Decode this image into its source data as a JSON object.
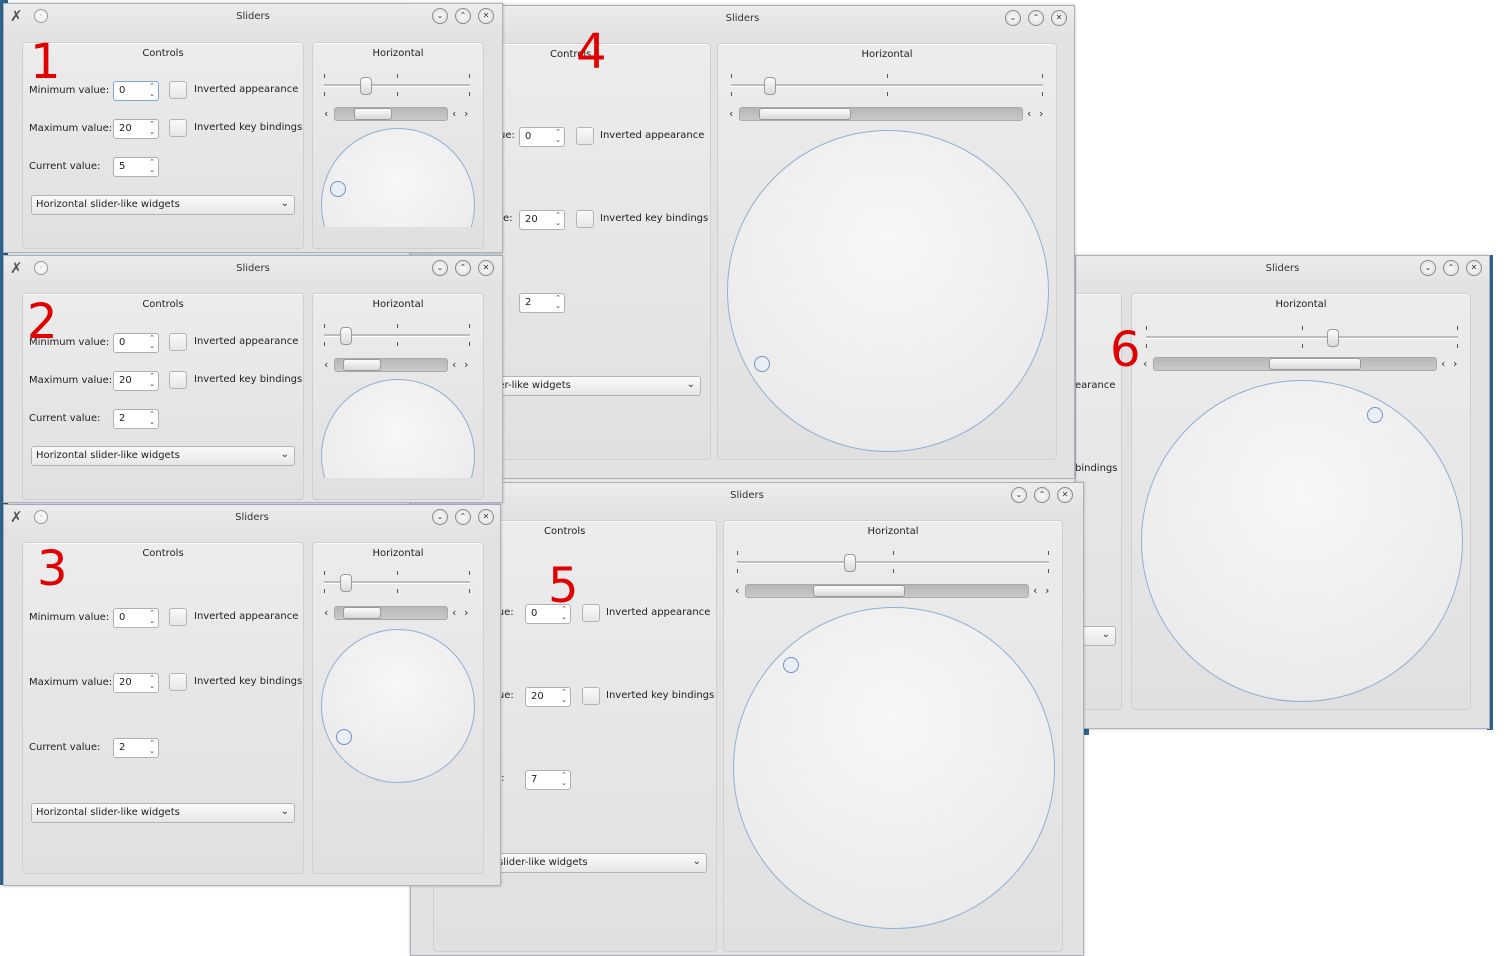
{
  "window_title": "Sliders",
  "controls_title": "Controls",
  "horizontal_title": "Horizontal",
  "labels": {
    "min": "Minimum value:",
    "max": "Maximum value:",
    "cur": "Current value:",
    "min_part": "ue:",
    "max_part": "e:",
    "cur_part": "e:",
    "min_part5": "lue:",
    "max_part5": "alue:",
    "cur_part5": "e:",
    "inv_app": "Inverted appearance",
    "inv_key": "Inverted key bindings",
    "inv_app_part": "earance",
    "inv_key_part": "bindings",
    "combo": "Horizontal slider-like widgets",
    "combo_part4": "der-like widgets",
    "combo_part5": "slider-like widgets",
    "controls_part": "Controls"
  },
  "annotations": [
    "1",
    "2",
    "3",
    "4",
    "5",
    "6"
  ],
  "windows": [
    {
      "id": "w1",
      "min": "0",
      "max": "20",
      "current": "5",
      "slider_fraction": 0.25
    },
    {
      "id": "w2",
      "min": "0",
      "max": "20",
      "current": "2",
      "slider_fraction": 0.1
    },
    {
      "id": "w3",
      "min": "0",
      "max": "20",
      "current": "2",
      "slider_fraction": 0.1
    },
    {
      "id": "w4",
      "min": "0",
      "max": "20",
      "current": "2",
      "slider_fraction": 0.1
    },
    {
      "id": "w5",
      "min": "0",
      "max": "20",
      "current": "7",
      "slider_fraction": 0.35
    },
    {
      "id": "w6",
      "min": "0",
      "max": "20",
      "current": "11",
      "slider_fraction": 0.6
    }
  ],
  "icons": {
    "app": "x-app-icon",
    "pin": "pin-icon",
    "minimize": "minimize-icon",
    "maximize": "maximize-icon",
    "close": "close-icon"
  },
  "colors": {
    "accent": "#8fb0d8",
    "annotation": "#e00000",
    "desktop": "#2f6590"
  }
}
